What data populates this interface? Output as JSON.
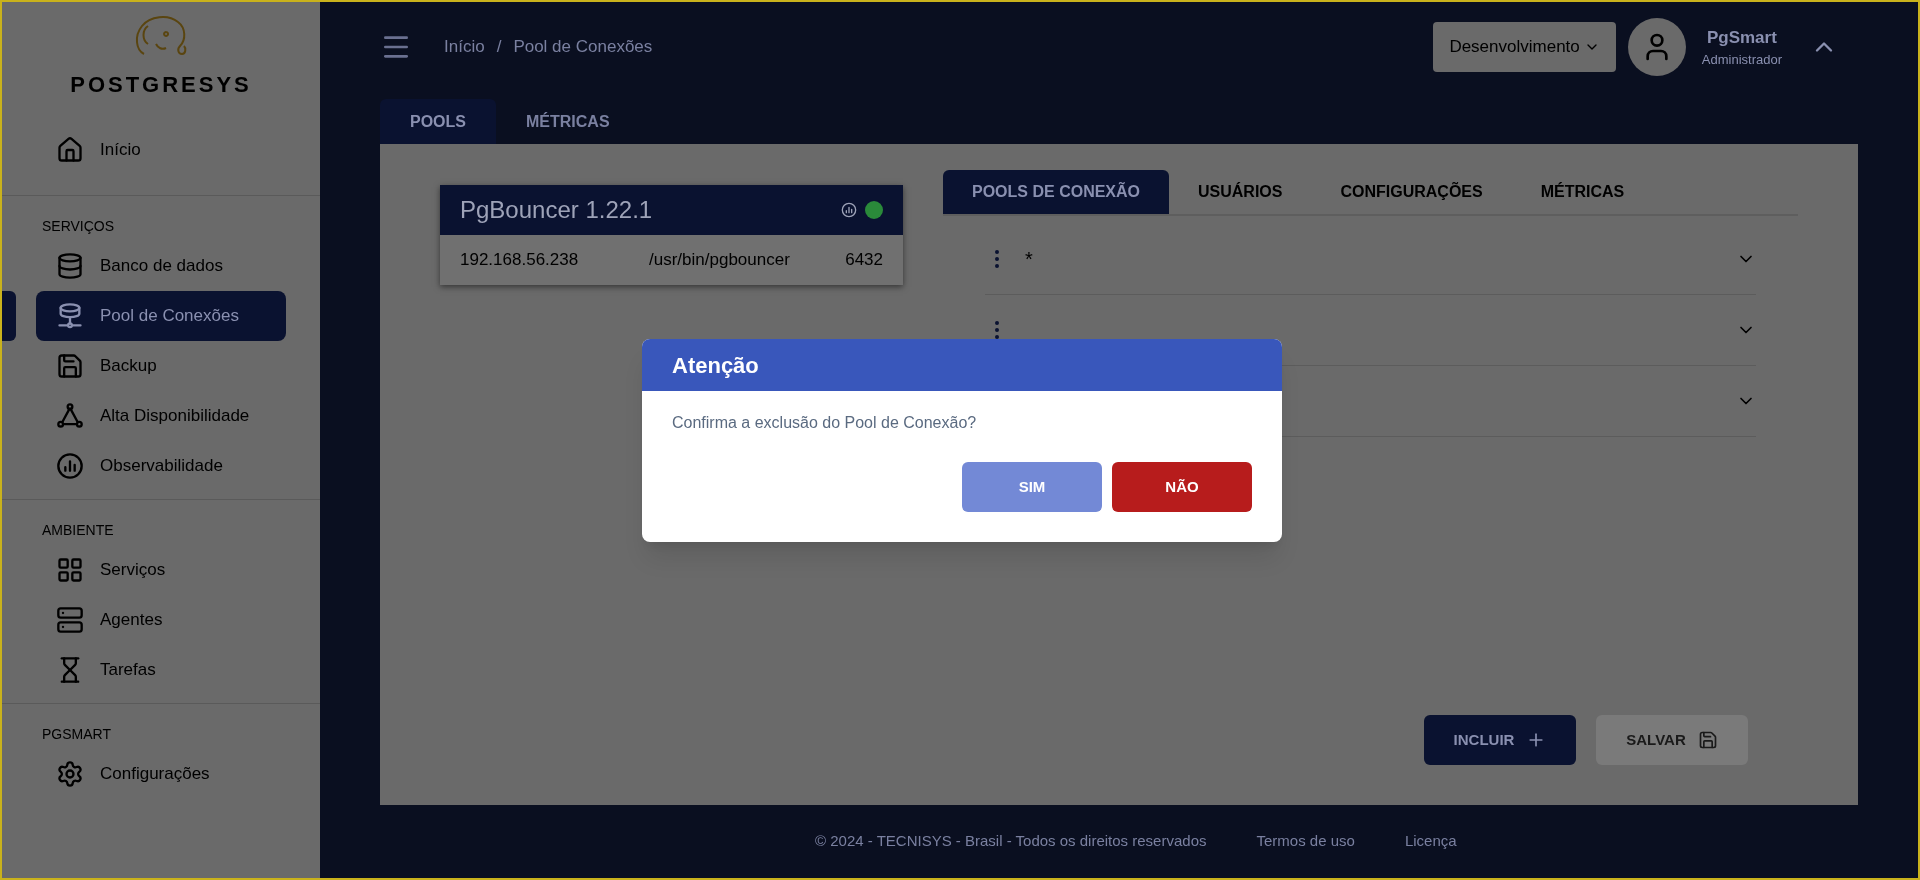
{
  "sidebar": {
    "logo": "POSTGRESYS",
    "sections": [
      {
        "items": [
          {
            "label": "Início",
            "selected": false
          }
        ]
      },
      {
        "heading": "SERVIÇOS",
        "items": [
          {
            "label": "Banco de dados",
            "selected": false
          },
          {
            "label": "Pool de Conexões",
            "selected": true
          },
          {
            "label": "Backup",
            "selected": false
          },
          {
            "label": "Alta Disponibilidade",
            "selected": false
          },
          {
            "label": "Observabilidade",
            "selected": false
          }
        ]
      },
      {
        "heading": "AMBIENTE",
        "items": [
          {
            "label": "Serviços",
            "selected": false
          },
          {
            "label": "Agentes",
            "selected": false
          },
          {
            "label": "Tarefas",
            "selected": false
          }
        ]
      },
      {
        "heading": "PGSMART",
        "items": [
          {
            "label": "Configurações",
            "selected": false
          }
        ]
      }
    ]
  },
  "header": {
    "breadcrumb": [
      "Início",
      "Pool de Conexões"
    ],
    "separator": "/",
    "environment": "Desenvolvimento",
    "user": {
      "name": "PgSmart",
      "role": "Administrador"
    }
  },
  "page_tabs": [
    {
      "label": "POOLS",
      "selected": true
    },
    {
      "label": "MÉTRICAS",
      "selected": false
    }
  ],
  "server_card": {
    "title": "PgBouncer 1.22.1",
    "online": true,
    "host": "192.168.56.238",
    "path": "/usr/bin/pgbouncer",
    "port": "6432"
  },
  "pool_tabs": [
    {
      "label": "POOLS DE CONEXÃO",
      "selected": true
    },
    {
      "label": "USUÁRIOS",
      "selected": false
    },
    {
      "label": "CONFIGURAÇÕES",
      "selected": false
    },
    {
      "label": "MÉTRICAS",
      "selected": false
    }
  ],
  "pools": [
    {
      "label": "*",
      "expanded": false
    },
    {
      "expanded": false
    },
    {
      "expanded": false
    }
  ],
  "actions": [
    {
      "label": "INCLUIR",
      "disabled": false
    },
    {
      "label": "SALVAR",
      "disabled": true
    }
  ],
  "dialog": {
    "title": "Atenção",
    "message": "Confirma a exclusão do Pool de Conexão?",
    "buttons": [
      {
        "label": "SIM",
        "kind": "confirm"
      },
      {
        "label": "NÃO",
        "kind": "cancel"
      }
    ]
  },
  "footer": {
    "copyright": "© 2024 - TECNISYS - Brasil - Todos os direitos reservados",
    "links": [
      "Termos de uso",
      "Licença"
    ]
  }
}
